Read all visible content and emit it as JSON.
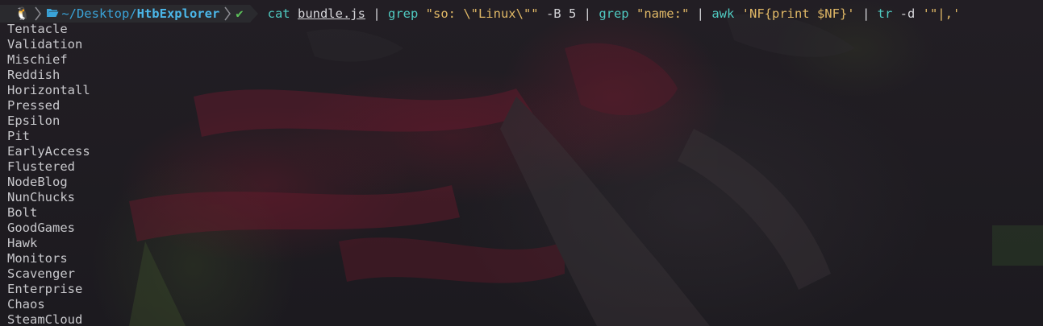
{
  "prompt": {
    "os_icon": "linux-tux-icon",
    "folder_icon": "folder-open-icon",
    "path_prefix": "~/Desktop/",
    "path_current": "HtbExplorer",
    "status_icon": "checkmark-icon",
    "status_glyph": "✔"
  },
  "command": {
    "cmd1": "cat",
    "arg1": "bundle.js",
    "pipe1": " | ",
    "cmd2": "grep",
    "arg2": "\"so: \\\"Linux\\\"\"",
    "flags2": " -B 5",
    "pipe2": " | ",
    "cmd3": "grep",
    "arg3": "\"name:\"",
    "pipe3": " | ",
    "cmd4": "awk",
    "arg4": "'NF{print $NF}'",
    "pipe4": " | ",
    "cmd5": "tr",
    "flags5": " -d ",
    "arg5": "'\"|,'"
  },
  "output_lines": [
    "Tentacle",
    "Validation",
    "Mischief",
    "Reddish",
    "Horizontall",
    "Pressed",
    "Epsilon",
    "Pit",
    "EarlyAccess",
    "Flustered",
    "NodeBlog",
    "NunChucks",
    "Bolt",
    "GoodGames",
    "Hawk",
    "Monitors",
    "Scavenger",
    "Enterprise",
    "Chaos",
    "SteamCloud"
  ]
}
